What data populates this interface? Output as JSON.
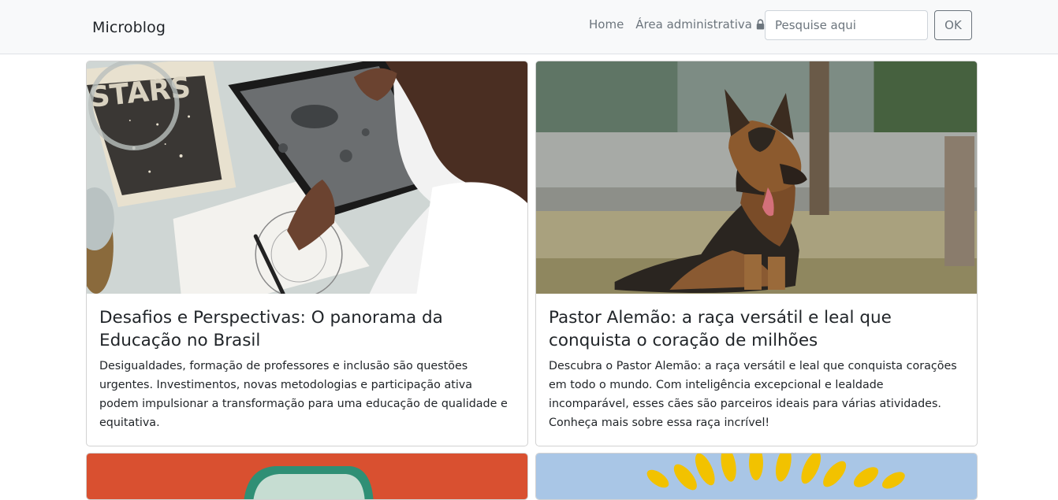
{
  "navbar": {
    "brand": "Microblog",
    "links": [
      "Home",
      "Área administrativa"
    ],
    "search_placeholder": "Pesquise aqui",
    "search_button": "OK"
  },
  "posts": [
    {
      "title": "Desafios e Perspectivas: O panorama da Educação no Brasil",
      "excerpt": "Desigualdades, formação de professores e inclusão são questões urgentes. Investimentos, novas metodologias e participação ativa podem impulsionar a transformação para uma educação de qualidade e equitativa.",
      "image": "child-tablet-moon-photo"
    },
    {
      "title": "Pastor Alemão: a raça versátil e leal que conquista o coração de milhões",
      "excerpt": "Descubra o Pastor Alemão: a raça versátil e leal que conquista corações em todo o mundo. Com inteligência excepcional e lealdade incomparável, esses cães são parceiros ideais para várias atividades. Conheça mais sobre essa raça incrível!",
      "image": "german-shepherd-photo"
    },
    {
      "image": "orange-background-photo"
    },
    {
      "image": "sunflower-sky-photo"
    }
  ],
  "icons": {
    "lock": "lock-icon"
  },
  "colors": {
    "navbar_bg": "#f8f9fa",
    "muted_text": "#6c757d",
    "border": "#dee2e6"
  }
}
